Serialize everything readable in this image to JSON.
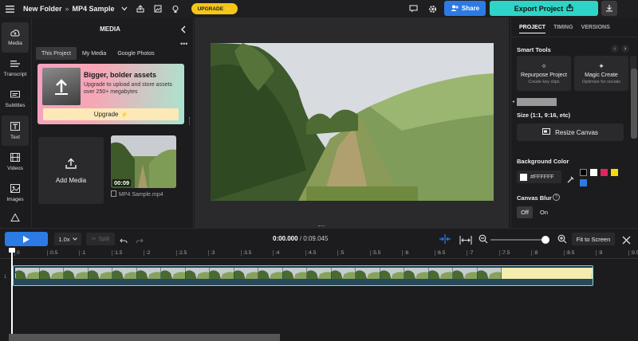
{
  "topbar": {
    "breadcrumb_folder": "New Folder",
    "breadcrumb_sep": "»",
    "project_name": "MP4 Sample",
    "upgrade_label": "UPGRADE",
    "share_label": "Share",
    "export_label": "Export Project"
  },
  "leftnav": {
    "items": [
      {
        "label": "Media",
        "icon": "cloud-upload-icon"
      },
      {
        "label": "Transcript",
        "icon": "transcript-icon"
      },
      {
        "label": "Subtitles",
        "icon": "subtitles-icon"
      },
      {
        "label": "Text",
        "icon": "text-icon"
      },
      {
        "label": "Videos",
        "icon": "film-icon"
      },
      {
        "label": "Images",
        "icon": "image-icon"
      },
      {
        "label": "",
        "icon": "shapes-icon"
      }
    ]
  },
  "media": {
    "title": "MEDIA",
    "tabs": [
      "This Project",
      "My Media",
      "Google Photos"
    ],
    "active_tab": "This Project",
    "promo": {
      "title": "Bigger, bolder assets",
      "text": "Upgrade to upload and store assets over 250+ megabytes",
      "button": "Upgrade"
    },
    "add_media_label": "Add Media",
    "file": {
      "duration": "00:09",
      "name": "MP4 Sample.mp4"
    }
  },
  "right_panel": {
    "tabs": [
      "PROJECT",
      "TIMING",
      "VERSIONS"
    ],
    "active_tab": "PROJECT",
    "smart_tools_label": "Smart Tools",
    "cards": [
      {
        "title": "Repurpose Project",
        "subtitle": "Create key clips"
      },
      {
        "title": "Magic Create",
        "subtitle": "Optimize for socials"
      }
    ],
    "size_label": "Size (1:1, 9:16, etc)",
    "resize_label": "Resize Canvas",
    "bg_color_label": "Background Color",
    "bg_color_value": "#FFFFFF",
    "swatches": [
      "#000000",
      "#ffffff",
      "#e0245e",
      "#f5d90a",
      "#2c7be5"
    ],
    "blur_label": "Canvas Blur",
    "blur_options": [
      "Off",
      "On"
    ],
    "blur_selected": "Off"
  },
  "timeline": {
    "speed": "1.0x",
    "split_label": "Split",
    "current_time": "0:00.000",
    "total_time": "0:09.045",
    "fit_label": "Fit to Screen",
    "zoom_level": 0.9,
    "track_number": "1",
    "ticks": [
      "0",
      ":0.5",
      ":1",
      ":1.5",
      ":2",
      ":2.5",
      ":3",
      ":3.5",
      ":4",
      ":4.5",
      ":5",
      ":5.5",
      ":6",
      ":6.5",
      ":7",
      ":7.5",
      ":8",
      ":8.5",
      ":9",
      ":9.5"
    ]
  },
  "colors": {
    "accent_blue": "#2c7be5",
    "export_teal": "#2fd4c8",
    "upgrade_yellow": "#f5c518"
  }
}
